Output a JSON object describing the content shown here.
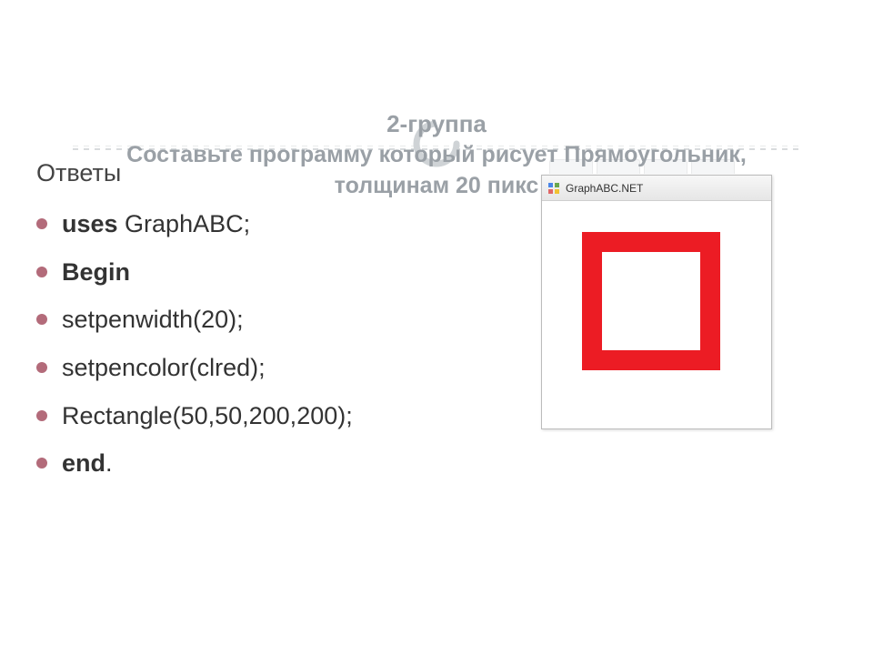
{
  "header": {
    "line1": "2-группа",
    "line2": "Составьте программу который рисует Прямоугольник,",
    "line3_prefix": "толщинам  20 пикс"
  },
  "answers_label": "Ответы",
  "code": {
    "items": [
      {
        "pre_bold": "uses",
        "rest": " GraphABC;"
      },
      {
        "pre_bold": "Begin",
        "rest": ""
      },
      {
        "pre_bold": "",
        "rest": "setpenwidth(20);"
      },
      {
        "pre_bold": "",
        "rest": "   setpencolor(clred);"
      },
      {
        "pre_bold": "",
        "rest": "Rectangle(50,50,200,200);"
      },
      {
        "pre_bold": "end",
        "rest": "."
      }
    ]
  },
  "window": {
    "title": "GraphABC.NET"
  },
  "colors": {
    "red": "#ec1c24",
    "heading_grey": "#9aa0a6",
    "bullet": "#b36b7a"
  }
}
